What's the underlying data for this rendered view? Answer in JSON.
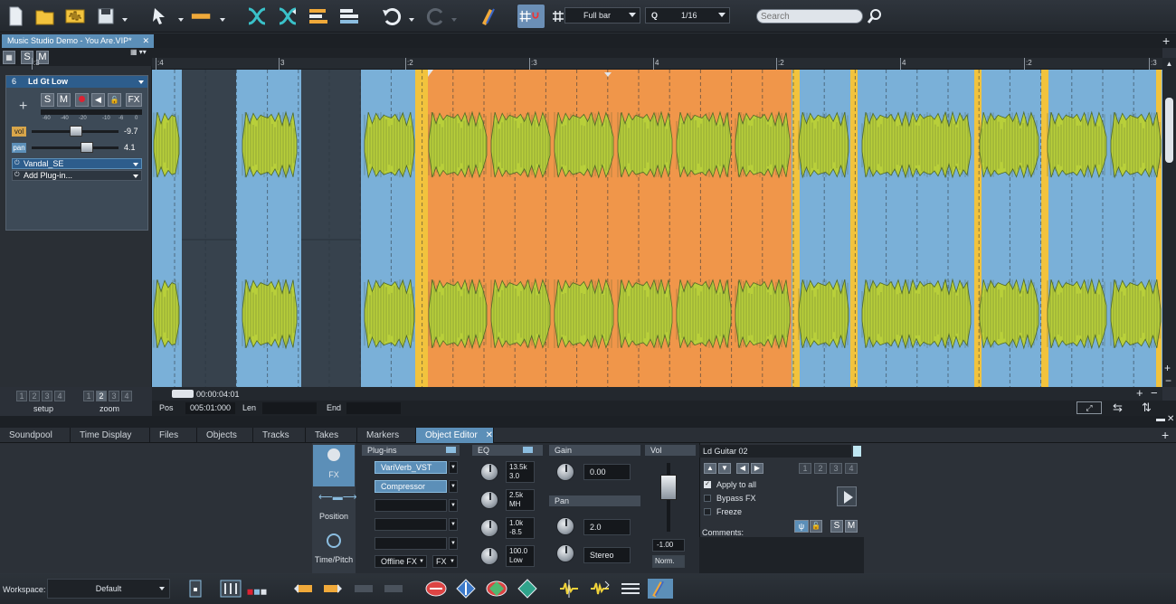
{
  "toolbar": {
    "snap_label": "Full bar",
    "quantize_label": "Q",
    "quantize_value": "1/16",
    "search_placeholder": "Search"
  },
  "tabs": {
    "document": "Music Studio Demo - You Are.VIP*"
  },
  "tracklist": {
    "s_label": "S",
    "m_label": "M",
    "number": "6",
    "name": "Ld Gt Low",
    "s_btn": "S",
    "m_btn": "M",
    "fx_btn": "FX",
    "add": "+",
    "vol_label": "vol",
    "vol_value": "-9.7",
    "pan_label": "pan",
    "pan_value": "4.1",
    "plugin1": "Vandal_SE",
    "plugin2": "Add Plug-in...",
    "meter_ticks": [
      "-60",
      "-40",
      "-20",
      "-10",
      "-6",
      "0"
    ],
    "setup_label": "setup",
    "zoom_label": "zoom",
    "nums": [
      "1",
      "2",
      "3",
      "4"
    ]
  },
  "ruler": {
    "labels": [
      ":3",
      ":4",
      "3",
      ":2",
      ":3",
      "4",
      ":2",
      "4",
      ":2",
      ":3"
    ]
  },
  "transport": {
    "time": "00:00:04:01",
    "pos_label": "Pos",
    "pos_value": "005:01:000",
    "len_label": "Len",
    "end_label": "End"
  },
  "lower_tabs": [
    "Soundpool",
    "Time Display",
    "Files",
    "Objects",
    "Tracks",
    "Takes",
    "Markers",
    "Object Editor"
  ],
  "object_editor": {
    "side": {
      "fx": "FX",
      "position": "Position",
      "time_pitch": "Time/Pitch"
    },
    "plugins": {
      "header": "Plug-ins",
      "slot1": "VariVerb_VST",
      "slot2": "Compressor",
      "offline": "Offline FX",
      "fx": "FX"
    },
    "eq": {
      "header": "EQ",
      "k1a": "13.5k",
      "k1b": "3.0",
      "k2a": "2.5k",
      "k2b": "MH",
      "k3a": "1.0k",
      "k3b": "-8.5",
      "k4a": "100.0",
      "k4b": "Low"
    },
    "gain": {
      "header": "Gain",
      "value": "0.00"
    },
    "pan": {
      "header": "Pan",
      "value": "2.0",
      "mode": "Stereo"
    },
    "vol": {
      "header": "Vol",
      "value": "-1.00",
      "norm": "Norm."
    },
    "object": {
      "name": "Ld Guitar 02",
      "apply_all": "Apply to all",
      "bypass": "Bypass FX",
      "freeze": "Freeze",
      "comments": "Comments:",
      "s": "S",
      "m": "M",
      "nums": [
        "1",
        "2",
        "3",
        "4"
      ]
    }
  },
  "bottom": {
    "workspace_label": "Workspace:",
    "workspace_value": "Default"
  },
  "colors": {
    "accent": "#5c8fb8",
    "selection": "#f0964a",
    "waveform": "#b8cf3a",
    "lane": "#7ab0d8"
  }
}
